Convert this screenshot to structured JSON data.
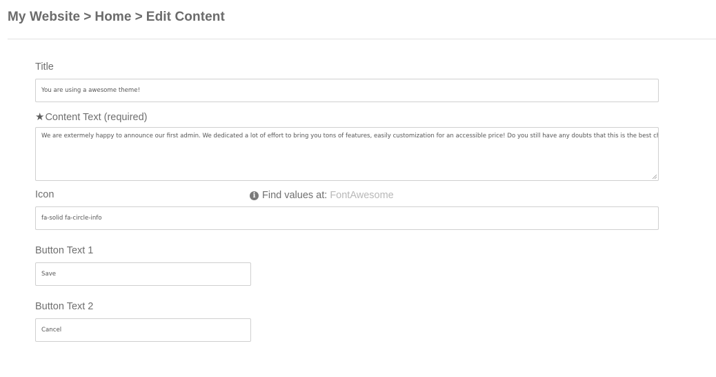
{
  "breadcrumb": {
    "site": "My Website",
    "home": "Home",
    "current": "Edit Content",
    "separator": ">"
  },
  "form": {
    "title": {
      "label": "Title",
      "value": "You are using a awesome theme!"
    },
    "content": {
      "required_icon": "★",
      "label": "Content Text (required)",
      "value": "We are extermely happy to announce our first admin. We dedicated a lot of effort to bring you tons of features, easily customization for an accessible price! Do you still have any doubts that this is the best choice?"
    },
    "icon": {
      "label": "Icon",
      "value": "fa-solid fa-circle-info",
      "hint_icon": "info-circle-icon",
      "hint_text": "Find values at:",
      "hint_link": "FontAwesome"
    },
    "button1": {
      "label": "Button Text 1",
      "value": "Save"
    },
    "button2": {
      "label": "Button Text 2",
      "value": "Cancel"
    }
  },
  "colors": {
    "text": "#6e6e6e",
    "border": "#cfcfcf",
    "link": "#b8b8b8",
    "divider": "#e2e2e2"
  }
}
